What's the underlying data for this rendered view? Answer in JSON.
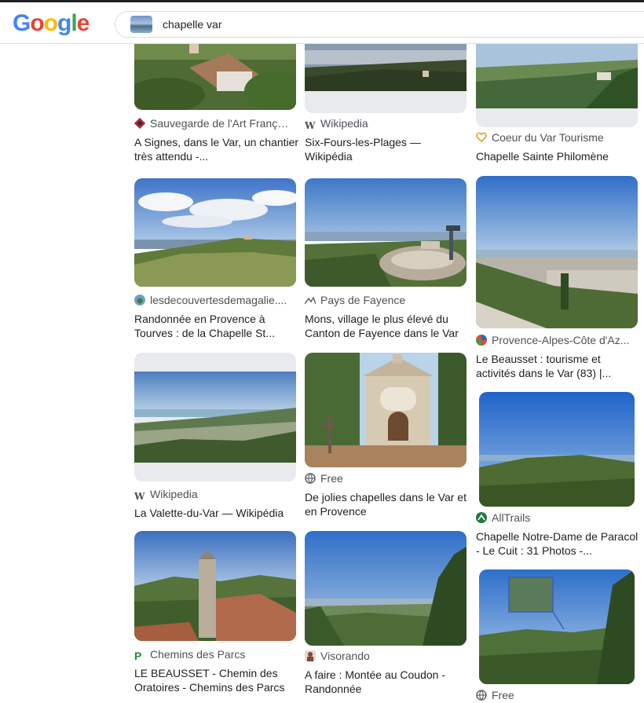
{
  "header": {
    "logo_letters": [
      "G",
      "o",
      "o",
      "g",
      "l",
      "e"
    ],
    "logo_colors": [
      "#4285f4",
      "#ea4335",
      "#fbbc05",
      "#4285f4",
      "#34a853",
      "#ea4335"
    ],
    "search_query": "chapelle var"
  },
  "results": [
    {
      "source": "Sauvegarde de l'Art Franç…",
      "title": "A Signes, dans le Var, un chantier très attendu -..."
    },
    {
      "source": "Wikipedia",
      "title": "Six-Fours-les-Plages — Wikipédia"
    },
    {
      "source": "Coeur du Var Tourisme",
      "title": "Chapelle Sainte Philomène"
    },
    {
      "source": "lesdecouvertesdemagalie....",
      "title": "Randonnée en Provence à Tourves : de la Chapelle St..."
    },
    {
      "source": "Pays de Fayence",
      "title": "Mons, village le plus élevé du Canton de Fayence dans le Var"
    },
    {
      "source": "Provence-Alpes-Côte d'Az...",
      "title": "Le Beausset : tourisme et activités dans le Var (83) |..."
    },
    {
      "source": "Wikipedia",
      "title": "La Valette-du-Var — Wikipédia"
    },
    {
      "source": "Free",
      "title": "De jolies chapelles dans le Var et en Provence"
    },
    {
      "source": "AllTrails",
      "title": "Chapelle Notre-Dame de Paracol - Le Cuit : 31 Photos -..."
    },
    {
      "source": "Chemins des Parcs",
      "title": "LE BEAUSSET - Chemin des Oratoires - Chemins des Parcs"
    },
    {
      "source": "Visorando",
      "title": "A faire : Montée au Coudon - Randonnée"
    },
    {
      "source": "Free",
      "title": ""
    }
  ]
}
